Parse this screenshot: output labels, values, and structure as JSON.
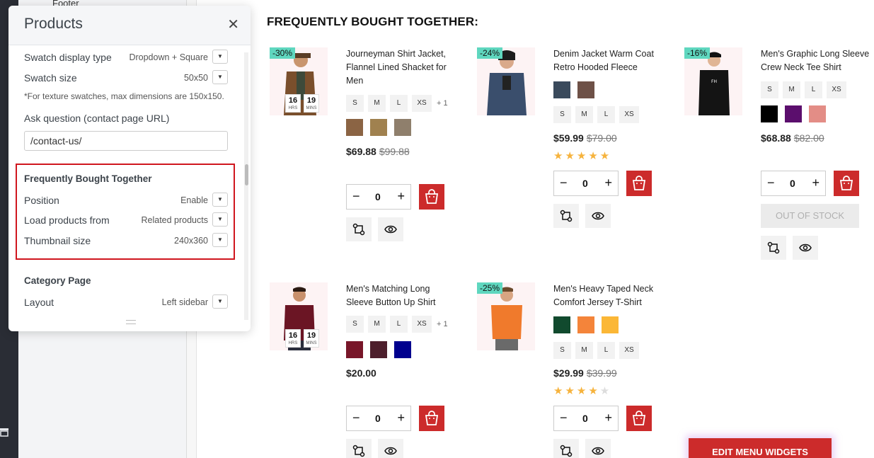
{
  "background": {
    "footer_label": "Footer"
  },
  "panel": {
    "title": "Products",
    "rows": {
      "swatch_display_type": {
        "label": "Swatch display type",
        "value": "Dropdown + Square"
      },
      "swatch_size": {
        "label": "Swatch size",
        "value": "50x50"
      },
      "texture_note": "*For texture swatches, max dimensions are 150x150.",
      "ask_question_label": "Ask question (contact page URL)",
      "ask_question_value": "/contact-us/"
    },
    "fbt": {
      "title": "Frequently Bought Together",
      "position": {
        "label": "Position",
        "value": "Enable"
      },
      "load_from": {
        "label": "Load products from",
        "value": "Related products"
      },
      "thumb_size": {
        "label": "Thumbnail size",
        "value": "240x360"
      }
    },
    "category": {
      "title": "Category Page",
      "layout": {
        "label": "Layout",
        "value": "Left sidebar"
      }
    }
  },
  "main": {
    "heading": "FREQUENTLY BOUGHT TOGETHER:",
    "products": [
      {
        "badge": "-30%",
        "timer": {
          "hrs": "16",
          "hrs_label": "HRS",
          "mins": "19",
          "mins_label": "MINS"
        },
        "name": "Journeyman Shirt Jacket, Flannel Lined Shacket for Men",
        "sizes": [
          "S",
          "M",
          "L",
          "XS"
        ],
        "more_sizes": "+ 1",
        "swatches": [
          "#8b6444",
          "#a0814f",
          "#8f7f6c"
        ],
        "price": "$69.88",
        "old_price": "$99.88",
        "qty": "0"
      },
      {
        "badge": "-24%",
        "name": "Denim Jacket Warm Coat Retro Hooded Fleece",
        "swatches": [
          "#3a4a5c",
          "#6e5147"
        ],
        "sizes": [
          "S",
          "M",
          "L",
          "XS"
        ],
        "price": "$59.99",
        "old_price": "$79.00",
        "rating": 5,
        "qty": "0"
      },
      {
        "badge": "-16%",
        "name": "Men's Graphic Long Sleeve Crew Neck Tee Shirt",
        "sizes": [
          "S",
          "M",
          "L",
          "XS"
        ],
        "swatches": [
          "#000000",
          "#5b0e6d",
          "#e38d86"
        ],
        "price": "$68.88",
        "old_price": "$82.00",
        "qty": "0",
        "out_of_stock": "OUT OF STOCK"
      },
      {
        "timer": {
          "hrs": "16",
          "hrs_label": "HRS",
          "mins": "19",
          "mins_label": "MINS"
        },
        "name": "Men's Matching Long Sleeve Button Up Shirt",
        "sizes": [
          "S",
          "M",
          "L",
          "XS"
        ],
        "more_sizes": "+ 1",
        "swatches": [
          "#781629",
          "#4d1f2c",
          "#00008e"
        ],
        "price": "$20.00",
        "qty": "0"
      },
      {
        "badge": "-25%",
        "name": "Men's Heavy Taped Neck Comfort Jersey T-Shirt",
        "swatches": [
          "#114a2e",
          "#f4843a",
          "#fbb736"
        ],
        "sizes": [
          "S",
          "M",
          "L",
          "XS"
        ],
        "price": "$29.99",
        "old_price": "$39.99",
        "rating": 4,
        "qty": "0"
      }
    ],
    "edit_button": "EDIT MENU WIDGETS"
  },
  "colors": {
    "accent_red": "#cc2b2b",
    "badge_teal": "#5fd7bf",
    "highlight_border": "#d0161e",
    "star": "#f6b33d"
  },
  "icons": {
    "close": "close-icon",
    "dropdown": "chevron-down-icon",
    "cart": "shopping-bag-icon",
    "compare": "compare-icon",
    "quick_view": "eye-icon"
  }
}
